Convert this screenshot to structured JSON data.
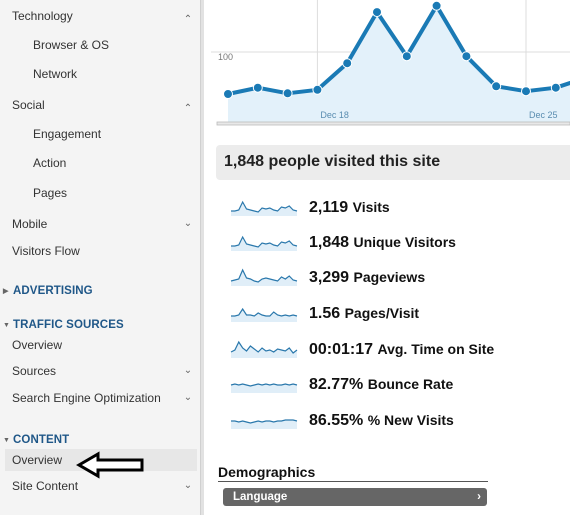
{
  "sidebar": {
    "items": [
      {
        "label": "Technology",
        "type": "group",
        "expanded": true,
        "chevron": "chevron-up-icon"
      },
      {
        "label": "Browser & OS",
        "type": "sub"
      },
      {
        "label": "Network",
        "type": "sub"
      },
      {
        "label": "Social",
        "type": "group",
        "expanded": true,
        "chevron": "chevron-up-icon"
      },
      {
        "label": "Engagement",
        "type": "sub"
      },
      {
        "label": "Action",
        "type": "sub"
      },
      {
        "label": "Pages",
        "type": "sub"
      },
      {
        "label": "Mobile",
        "type": "group",
        "expanded": false,
        "chevron": "chevron-down-icon"
      },
      {
        "label": "Visitors Flow",
        "type": "item"
      }
    ],
    "sections": {
      "advertising": {
        "label": "ADVERTISING",
        "expanded": false
      },
      "traffic_sources": {
        "label": "TRAFFIC SOURCES",
        "expanded": true,
        "items": [
          {
            "label": "Overview"
          },
          {
            "label": "Sources",
            "chevron": "chevron-down-icon"
          },
          {
            "label": "Search Engine Optimization",
            "chevron": "chevron-down-icon"
          }
        ]
      },
      "content": {
        "label": "CONTENT",
        "expanded": true,
        "items": [
          {
            "label": "Overview",
            "active": true
          },
          {
            "label": "Site Content",
            "chevron": "chevron-down-icon"
          }
        ]
      }
    },
    "icons": {
      "chevron_up": "⌃",
      "chevron_down": "⌄",
      "triangle_right": "▶",
      "triangle_down": "▼"
    }
  },
  "annotation": {
    "arrow": "left-arrow pointing to Content > Overview"
  },
  "chart_data": {
    "type": "area",
    "series": [
      {
        "name": "Visits",
        "values": [
          40,
          49,
          41,
          46,
          84,
          157,
          94,
          166,
          94,
          51,
          44,
          49,
          63
        ]
      }
    ],
    "x_tick_labels": [
      "Dec 18",
      "Dec 25"
    ],
    "y_tick_labels": [
      "100"
    ],
    "ylim": [
      0,
      175
    ],
    "grid": true,
    "color": "#1a7ab5",
    "fill": "#e3f1fa"
  },
  "summary": {
    "header": "1,848 people visited this site",
    "metrics": [
      {
        "value": "2,119",
        "name": "Visits",
        "spark": [
          3,
          3,
          4,
          12,
          5,
          4,
          3,
          2,
          6,
          5,
          6,
          4,
          3,
          7,
          6,
          8,
          4,
          3
        ]
      },
      {
        "value": "1,848",
        "name": "Unique Visitors",
        "spark": [
          3,
          3,
          4,
          12,
          5,
          4,
          3,
          2,
          6,
          5,
          6,
          4,
          3,
          7,
          6,
          8,
          4,
          3
        ]
      },
      {
        "value": "3,299",
        "name": "Pageviews",
        "spark": [
          3,
          4,
          5,
          14,
          6,
          5,
          3,
          2,
          5,
          6,
          5,
          4,
          3,
          7,
          5,
          8,
          4,
          3
        ]
      },
      {
        "value": "1.56",
        "name": "Pages/Visit",
        "spark": [
          4,
          4,
          5,
          11,
          5,
          5,
          4,
          7,
          5,
          4,
          4,
          8,
          5,
          4,
          5,
          4,
          5,
          4
        ]
      },
      {
        "value": "00:01:17",
        "name": "Avg. Time on Site",
        "spark": [
          4,
          6,
          14,
          8,
          5,
          10,
          7,
          4,
          8,
          5,
          6,
          4,
          7,
          6,
          5,
          8,
          3,
          6
        ]
      },
      {
        "value": "82.77%",
        "name": "Bounce Rate",
        "spark": [
          6,
          7,
          6,
          7,
          6,
          5,
          6,
          7,
          6,
          7,
          6,
          7,
          6,
          6,
          7,
          6,
          7,
          6
        ]
      },
      {
        "value": "86.55%",
        "name": "% New Visits",
        "spark": [
          6,
          6,
          5,
          6,
          5,
          4,
          5,
          6,
          5,
          6,
          6,
          5,
          6,
          6,
          7,
          7,
          7,
          6
        ]
      }
    ]
  },
  "demographics": {
    "title": "Demographics",
    "button": {
      "label": "Language",
      "chevron": "›"
    }
  }
}
